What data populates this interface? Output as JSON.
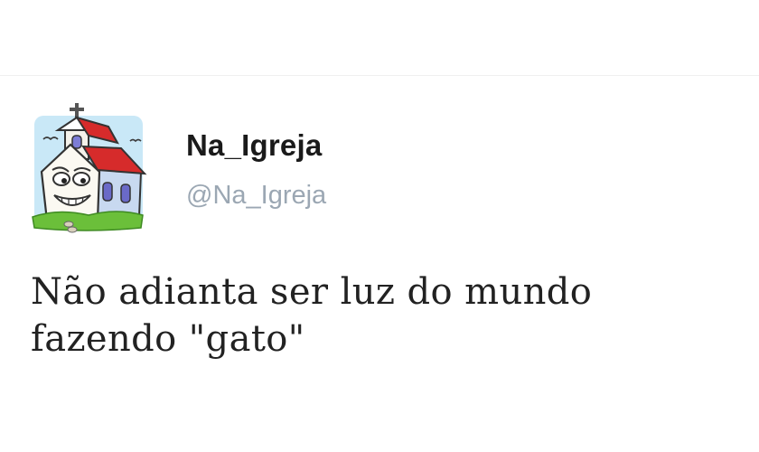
{
  "tweet": {
    "display_name": "Na_Igreja",
    "handle": "@Na_Igreja",
    "text_lines": [
      "Não adianta ser luz do mundo",
      "fazendo \"gato\""
    ],
    "avatar_icon": "cartoon-church-icon"
  },
  "colors": {
    "display_name": "#1a1a1a",
    "handle": "#9ba7b3",
    "text": "#222222",
    "roof": "#d62b2b",
    "grass": "#6bbf3a"
  }
}
